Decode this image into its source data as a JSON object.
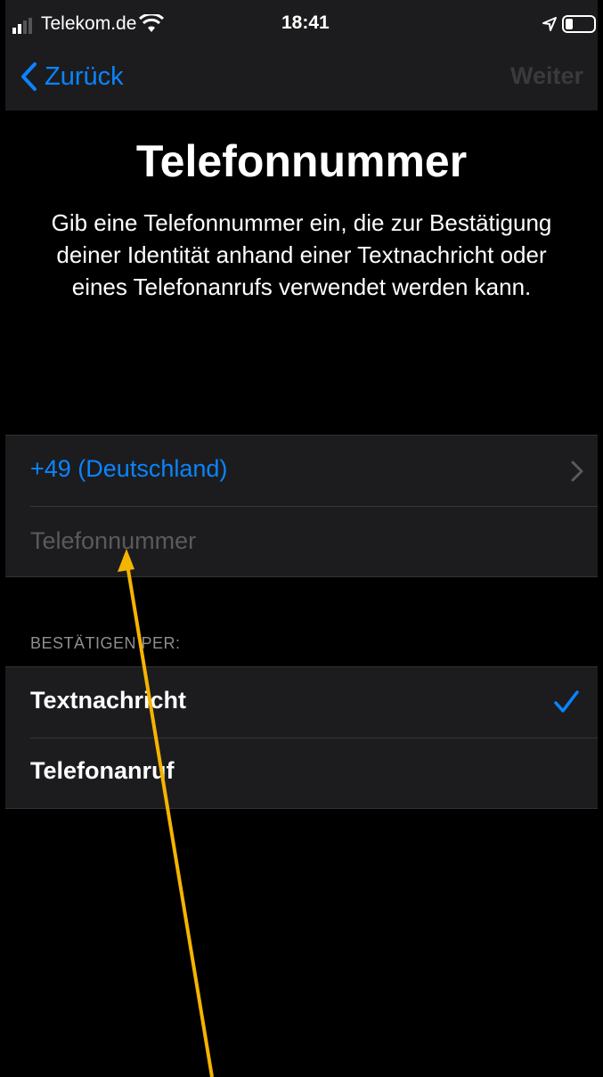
{
  "status_bar": {
    "carrier": "Telekom.de",
    "time": "18:41",
    "icons": [
      "signal-icon",
      "wifi-icon",
      "location-icon",
      "battery-icon"
    ]
  },
  "nav": {
    "back_label": "Zurück",
    "next_label": "Weiter"
  },
  "title": "Telefonnummer",
  "description": "Gib eine Telefonnummer ein, die zur Bestätigung deiner Identität anhand einer Textnachricht oder eines Telefonanrufs verwendet werden kann.",
  "phone": {
    "country": "+49 (Deutschland)",
    "placeholder": "Telefonnummer",
    "value": ""
  },
  "verify": {
    "header": "BESTÄTIGEN PER:",
    "options": [
      {
        "label": "Textnachricht",
        "selected": true
      },
      {
        "label": "Telefonanruf",
        "selected": false
      }
    ]
  },
  "colors": {
    "accent": "#0a84ff",
    "background": "#000000",
    "cell": "#1c1c1e",
    "annotation_arrow": "#f5b400"
  }
}
